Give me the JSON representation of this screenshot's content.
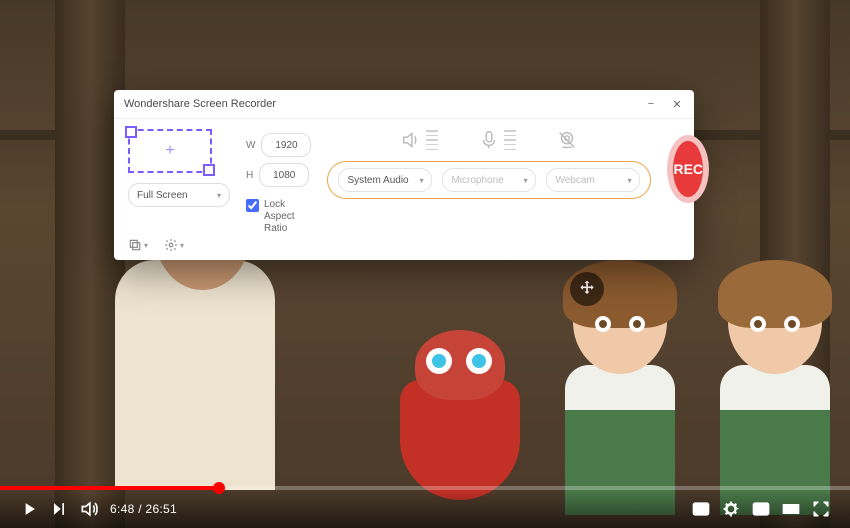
{
  "player": {
    "time_current": "6:48",
    "time_sep": " / ",
    "time_total": "26:51",
    "progress_pct": 25.8
  },
  "recorder": {
    "title": "Wondershare Screen Recorder",
    "frame_plus": "+",
    "full_screen_label": "Full Screen",
    "w_label": "W",
    "h_label": "H",
    "width_value": "1920",
    "height_value": "1080",
    "lock_label": "Lock Aspect Ratio",
    "system_audio": "System Audio",
    "microphone": "Microphone",
    "webcam": "Webcam",
    "rec_label": "REC"
  }
}
